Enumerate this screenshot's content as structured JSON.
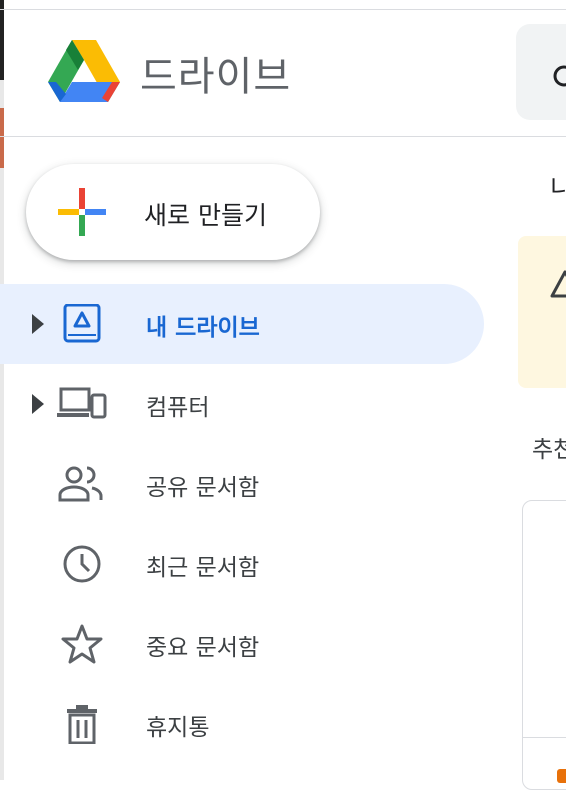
{
  "app": {
    "title": "드라이브"
  },
  "new_button": {
    "label": "새로 만들기",
    "icon": "plus-icon"
  },
  "sidebar": {
    "items": [
      {
        "label": "내 드라이브",
        "icon": "my-drive-icon",
        "active": true,
        "expandable": true
      },
      {
        "label": "컴퓨터",
        "icon": "computers-icon",
        "active": false,
        "expandable": true
      },
      {
        "label": "공유 문서함",
        "icon": "shared-icon",
        "active": false,
        "expandable": false
      },
      {
        "label": "최근 문서함",
        "icon": "clock-icon",
        "active": false,
        "expandable": false
      },
      {
        "label": "중요 문서함",
        "icon": "star-icon",
        "active": false,
        "expandable": false
      },
      {
        "label": "휴지통",
        "icon": "trash-icon",
        "active": false,
        "expandable": false
      }
    ]
  },
  "main": {
    "tab_fragment": "니",
    "section_fragment": "추천"
  },
  "colors": {
    "active_bg": "#e8f0fe",
    "active_text": "#1967d2",
    "notice_bg": "#fef7e0",
    "search_bg": "#f1f3f4"
  }
}
